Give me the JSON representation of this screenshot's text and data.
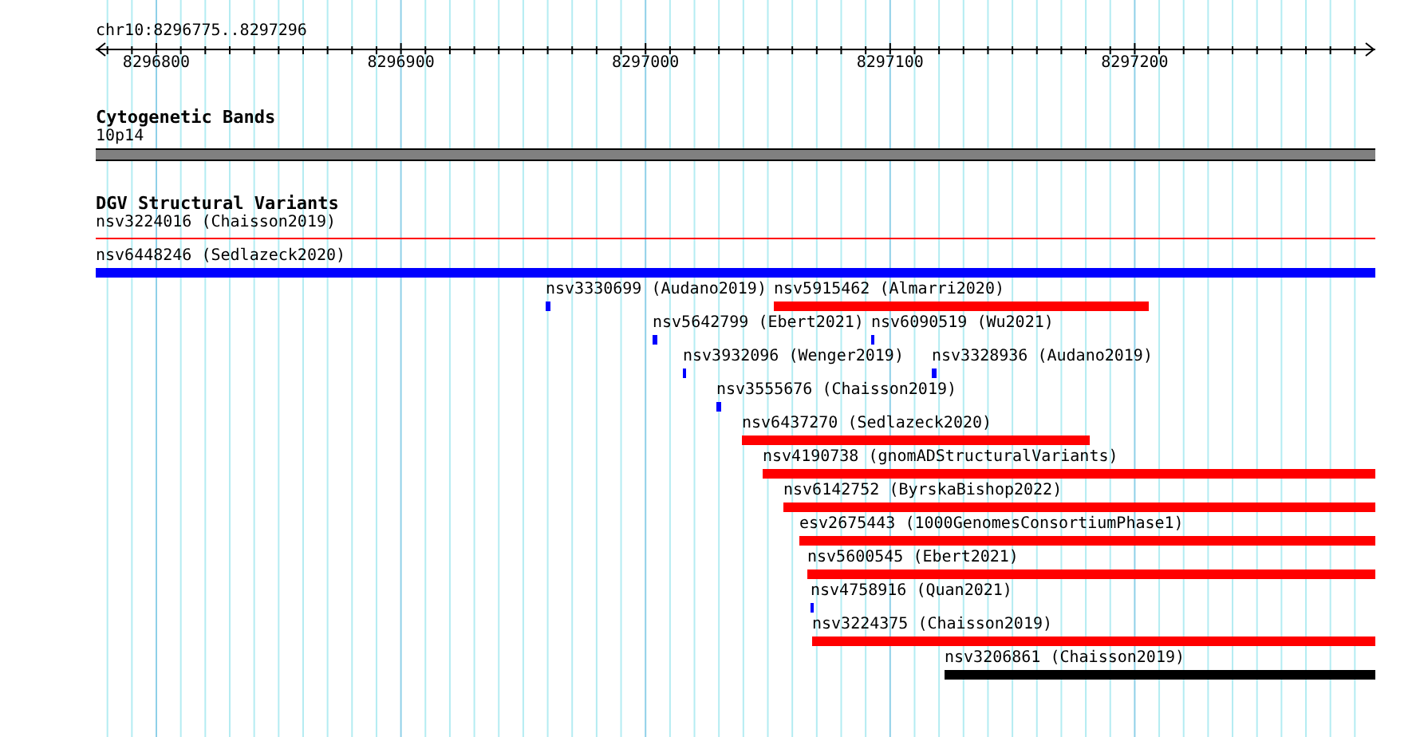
{
  "ruler": {
    "location": "chr10:8296775..8297296",
    "ticks": [
      "8296800",
      "8296900",
      "8297000",
      "8297100",
      "8297200"
    ]
  },
  "tracks": [
    {
      "kind": "bands",
      "title": "Cytogenetic Bands",
      "features": [
        {
          "label": "10p14",
          "color": "#808080"
        }
      ]
    },
    {
      "kind": "variants",
      "title": "DGV Structural Variants",
      "features": [
        {
          "label": "nsv3224016 (Chaisson2019)",
          "kind": "line",
          "color": "#ff0000"
        },
        {
          "label": "nsv6448246 (Sedlazeck2020)",
          "kind": "bar",
          "color": "#0000ff"
        },
        {
          "label": "nsv3330699 (Audano2019)",
          "kind": "bar",
          "color": "#0000ff"
        },
        {
          "label": "nsv5915462 (Almarri2020)",
          "kind": "bar",
          "color": "#ff0000"
        },
        {
          "label": "nsv5642799 (Ebert2021)",
          "kind": "bar",
          "color": "#0000ff"
        },
        {
          "label": "nsv6090519 (Wu2021)",
          "kind": "bar",
          "color": "#0000ff"
        },
        {
          "label": "nsv3932096 (Wenger2019)",
          "kind": "bar",
          "color": "#0000ff"
        },
        {
          "label": "nsv3328936 (Audano2019)",
          "kind": "bar",
          "color": "#0000ff"
        },
        {
          "label": "nsv3555676 (Chaisson2019)",
          "kind": "bar",
          "color": "#0000ff"
        },
        {
          "label": "nsv6437270 (Sedlazeck2020)",
          "kind": "bar",
          "color": "#ff0000"
        },
        {
          "label": "nsv4190738 (gnomADStructuralVariants)",
          "kind": "bar",
          "color": "#ff0000"
        },
        {
          "label": "nsv6142752 (ByrskaBishop2022)",
          "kind": "bar",
          "color": "#ff0000"
        },
        {
          "label": "esv2675443 (1000GenomesConsortiumPhase1)",
          "kind": "bar",
          "color": "#ff0000"
        },
        {
          "label": "nsv5600545 (Ebert2021)",
          "kind": "bar",
          "color": "#ff0000"
        },
        {
          "label": "nsv4758916 (Quan2021)",
          "kind": "bar",
          "color": "#0000ff"
        },
        {
          "label": "nsv3224375 (Chaisson2019)",
          "kind": "bar",
          "color": "#ff0000"
        },
        {
          "label": "nsv3206861 (Chaisson2019)",
          "kind": "bar",
          "color": "#000000"
        }
      ]
    }
  ]
}
